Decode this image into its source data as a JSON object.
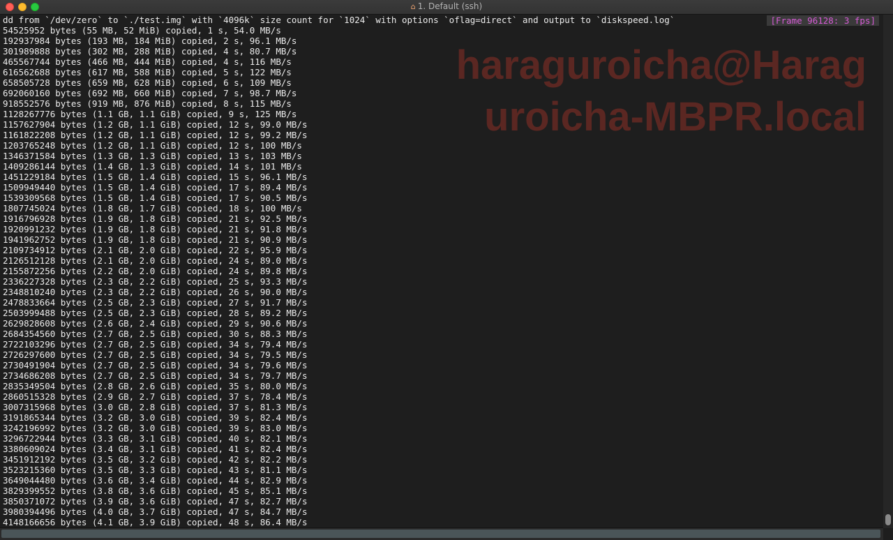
{
  "window": {
    "title": "1. Default (ssh)",
    "title_icon": "home-icon",
    "colors": {
      "background": "#1e1e1e",
      "text": "#ececec",
      "badge_text": "#d65bd6",
      "watermark": "#5f2823"
    }
  },
  "terminal": {
    "command_line": "dd from `/dev/zero` to `./test.img` with `4096k` size count for `1024` with options `oflag=direct` and output to `diskspeed.log`",
    "frame_indicator": "[Frame 96128: 3 fps]",
    "watermark": [
      "haraguroicha@Harag",
      "uroicha-MBPR.local"
    ],
    "lines": [
      "54525952 bytes (55 MB, 52 MiB) copied, 1 s, 54.0 MB/s",
      "192937984 bytes (193 MB, 184 MiB) copied, 2 s, 96.1 MB/s",
      "301989888 bytes (302 MB, 288 MiB) copied, 4 s, 80.7 MB/s",
      "465567744 bytes (466 MB, 444 MiB) copied, 4 s, 116 MB/s",
      "616562688 bytes (617 MB, 588 MiB) copied, 5 s, 122 MB/s",
      "658505728 bytes (659 MB, 628 MiB) copied, 6 s, 109 MB/s",
      "692060160 bytes (692 MB, 660 MiB) copied, 7 s, 98.7 MB/s",
      "918552576 bytes (919 MB, 876 MiB) copied, 8 s, 115 MB/s",
      "1128267776 bytes (1.1 GB, 1.1 GiB) copied, 9 s, 125 MB/s",
      "1157627904 bytes (1.2 GB, 1.1 GiB) copied, 12 s, 99.0 MB/s",
      "1161822208 bytes (1.2 GB, 1.1 GiB) copied, 12 s, 99.2 MB/s",
      "1203765248 bytes (1.2 GB, 1.1 GiB) copied, 12 s, 100 MB/s",
      "1346371584 bytes (1.3 GB, 1.3 GiB) copied, 13 s, 103 MB/s",
      "1409286144 bytes (1.4 GB, 1.3 GiB) copied, 14 s, 101 MB/s",
      "1451229184 bytes (1.5 GB, 1.4 GiB) copied, 15 s, 96.1 MB/s",
      "1509949440 bytes (1.5 GB, 1.4 GiB) copied, 17 s, 89.4 MB/s",
      "1539309568 bytes (1.5 GB, 1.4 GiB) copied, 17 s, 90.5 MB/s",
      "1807745024 bytes (1.8 GB, 1.7 GiB) copied, 18 s, 100 MB/s",
      "1916796928 bytes (1.9 GB, 1.8 GiB) copied, 21 s, 92.5 MB/s",
      "1920991232 bytes (1.9 GB, 1.8 GiB) copied, 21 s, 91.8 MB/s",
      "1941962752 bytes (1.9 GB, 1.8 GiB) copied, 21 s, 90.9 MB/s",
      "2109734912 bytes (2.1 GB, 2.0 GiB) copied, 22 s, 95.9 MB/s",
      "2126512128 bytes (2.1 GB, 2.0 GiB) copied, 24 s, 89.0 MB/s",
      "2155872256 bytes (2.2 GB, 2.0 GiB) copied, 24 s, 89.8 MB/s",
      "2336227328 bytes (2.3 GB, 2.2 GiB) copied, 25 s, 93.3 MB/s",
      "2348810240 bytes (2.3 GB, 2.2 GiB) copied, 26 s, 90.0 MB/s",
      "2478833664 bytes (2.5 GB, 2.3 GiB) copied, 27 s, 91.7 MB/s",
      "2503999488 bytes (2.5 GB, 2.3 GiB) copied, 28 s, 89.2 MB/s",
      "2629828608 bytes (2.6 GB, 2.4 GiB) copied, 29 s, 90.6 MB/s",
      "2684354560 bytes (2.7 GB, 2.5 GiB) copied, 30 s, 88.3 MB/s",
      "2722103296 bytes (2.7 GB, 2.5 GiB) copied, 34 s, 79.4 MB/s",
      "2726297600 bytes (2.7 GB, 2.5 GiB) copied, 34 s, 79.5 MB/s",
      "2730491904 bytes (2.7 GB, 2.5 GiB) copied, 34 s, 79.6 MB/s",
      "2734686208 bytes (2.7 GB, 2.5 GiB) copied, 34 s, 79.7 MB/s",
      "2835349504 bytes (2.8 GB, 2.6 GiB) copied, 35 s, 80.0 MB/s",
      "2860515328 bytes (2.9 GB, 2.7 GiB) copied, 37 s, 78.4 MB/s",
      "3007315968 bytes (3.0 GB, 2.8 GiB) copied, 37 s, 81.3 MB/s",
      "3191865344 bytes (3.2 GB, 3.0 GiB) copied, 39 s, 82.4 MB/s",
      "3242196992 bytes (3.2 GB, 3.0 GiB) copied, 39 s, 83.0 MB/s",
      "3296722944 bytes (3.3 GB, 3.1 GiB) copied, 40 s, 82.1 MB/s",
      "3380609024 bytes (3.4 GB, 3.1 GiB) copied, 41 s, 82.4 MB/s",
      "3451912192 bytes (3.5 GB, 3.2 GiB) copied, 42 s, 82.2 MB/s",
      "3523215360 bytes (3.5 GB, 3.3 GiB) copied, 43 s, 81.1 MB/s",
      "3649044480 bytes (3.6 GB, 3.4 GiB) copied, 44 s, 82.9 MB/s",
      "3829399552 bytes (3.8 GB, 3.6 GiB) copied, 45 s, 85.1 MB/s",
      "3850371072 bytes (3.9 GB, 3.6 GiB) copied, 47 s, 82.7 MB/s",
      "3980394496 bytes (4.0 GB, 3.7 GiB) copied, 47 s, 84.7 MB/s",
      "4148166656 bytes (4.1 GB, 3.9 GiB) copied, 48 s, 86.4 MB/s"
    ]
  }
}
